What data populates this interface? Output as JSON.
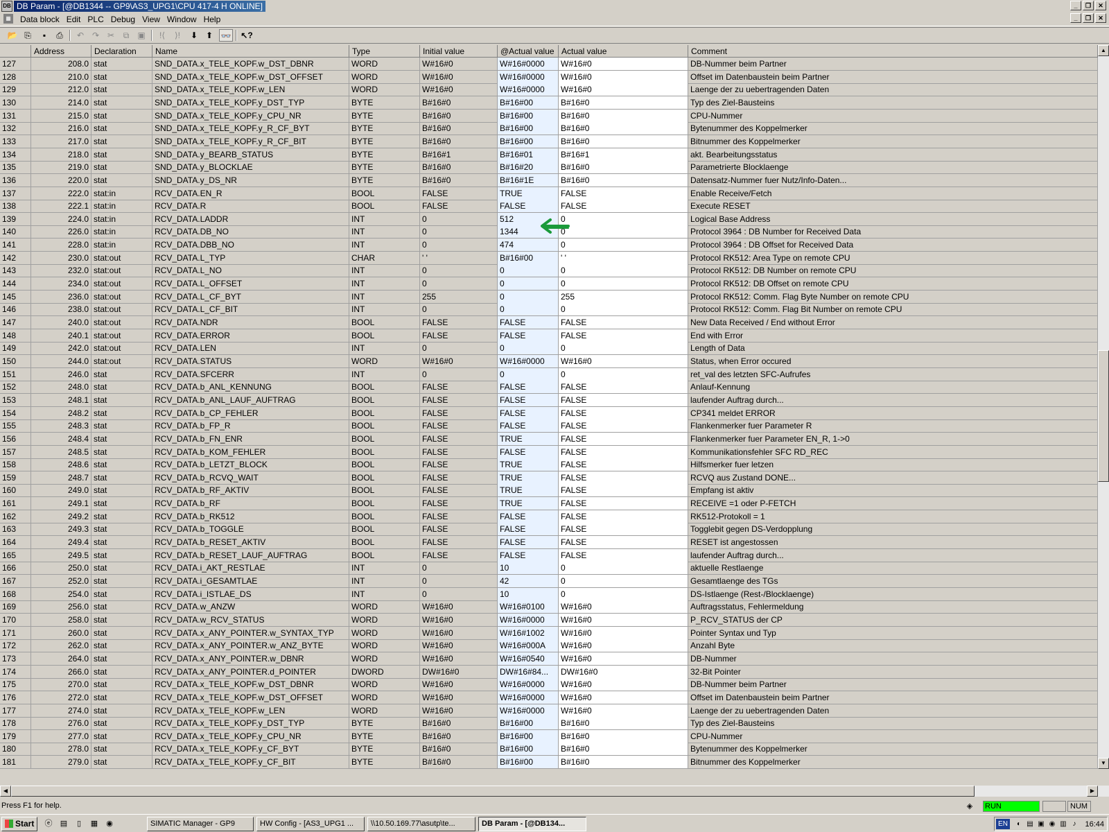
{
  "window": {
    "title": "DB Param - [@DB1344 -- GP9\\AS3_UPG1\\CPU 417-4 H  ONLINE]",
    "sys_icon": "DB"
  },
  "menu": [
    "Data block",
    "Edit",
    "PLC",
    "Debug",
    "View",
    "Window",
    "Help"
  ],
  "toolbar_icons": [
    "open-icon",
    "network-icon",
    "save-icon",
    "print-icon",
    "undo-icon",
    "redo-icon",
    "cut-icon",
    "copy-icon",
    "paste-icon",
    "breakpoint-icon",
    "step-icon",
    "download-icon",
    "upload-icon",
    "monitor-icon",
    "help-icon"
  ],
  "columns": [
    "Address",
    "Declaration",
    "Name",
    "Type",
    "Initial value",
    "@Actual value",
    "Actual value",
    "Comment"
  ],
  "rows": [
    [
      "127",
      "208.0",
      "stat",
      "SND_DATA.x_TELE_KOPF.w_DST_DBNR",
      "WORD",
      "W#16#0",
      "W#16#0000",
      "W#16#0",
      "DB-Nummer beim Partner"
    ],
    [
      "128",
      "210.0",
      "stat",
      "SND_DATA.x_TELE_KOPF.w_DST_OFFSET",
      "WORD",
      "W#16#0",
      "W#16#0000",
      "W#16#0",
      "Offset im Datenbaustein beim Partner"
    ],
    [
      "129",
      "212.0",
      "stat",
      "SND_DATA.x_TELE_KOPF.w_LEN",
      "WORD",
      "W#16#0",
      "W#16#0000",
      "W#16#0",
      "Laenge der zu uebertragenden Daten"
    ],
    [
      "130",
      "214.0",
      "stat",
      "SND_DATA.x_TELE_KOPF.y_DST_TYP",
      "BYTE",
      "B#16#0",
      "B#16#00",
      "B#16#0",
      "Typ des Ziel-Bausteins"
    ],
    [
      "131",
      "215.0",
      "stat",
      "SND_DATA.x_TELE_KOPF.y_CPU_NR",
      "BYTE",
      "B#16#0",
      "B#16#00",
      "B#16#0",
      "CPU-Nummer"
    ],
    [
      "132",
      "216.0",
      "stat",
      "SND_DATA.x_TELE_KOPF.y_R_CF_BYT",
      "BYTE",
      "B#16#0",
      "B#16#00",
      "B#16#0",
      "Bytenummer des Koppelmerker"
    ],
    [
      "133",
      "217.0",
      "stat",
      "SND_DATA.x_TELE_KOPF.y_R_CF_BIT",
      "BYTE",
      "B#16#0",
      "B#16#00",
      "B#16#0",
      "Bitnummer  des Koppelmerker"
    ],
    [
      "134",
      "218.0",
      "stat",
      "SND_DATA.y_BEARB_STATUS",
      "BYTE",
      "B#16#1",
      "B#16#01",
      "B#16#1",
      "akt. Bearbeitungsstatus"
    ],
    [
      "135",
      "219.0",
      "stat",
      "SND_DATA.y_BLOCKLAE",
      "BYTE",
      "B#16#0",
      "B#16#20",
      "B#16#0",
      "Parametrierte Blocklaenge"
    ],
    [
      "136",
      "220.0",
      "stat",
      "SND_DATA.y_DS_NR",
      "BYTE",
      "B#16#0",
      "B#16#1E",
      "B#16#0",
      "Datensatz-Nummer fuer Nutz/Info-Daten..."
    ],
    [
      "137",
      "222.0",
      "stat:in",
      "RCV_DATA.EN_R",
      "BOOL",
      "FALSE",
      "TRUE",
      "FALSE",
      "Enable Receive/Fetch"
    ],
    [
      "138",
      "222.1",
      "stat:in",
      "RCV_DATA.R",
      "BOOL",
      "FALSE",
      "FALSE",
      "FALSE",
      "Execute RESET"
    ],
    [
      "139",
      "224.0",
      "stat:in",
      "RCV_DATA.LADDR",
      "INT",
      "0",
      "512",
      "0",
      "Logical Base Address"
    ],
    [
      "140",
      "226.0",
      "stat:in",
      "RCV_DATA.DB_NO",
      "INT",
      "0",
      "1344",
      "0",
      "Protocol 3964 : DB Number for Received Data"
    ],
    [
      "141",
      "228.0",
      "stat:in",
      "RCV_DATA.DBB_NO",
      "INT",
      "0",
      "474",
      "0",
      "Protocol 3964 : DB Offset for Received Data"
    ],
    [
      "142",
      "230.0",
      "stat:out",
      "RCV_DATA.L_TYP",
      "CHAR",
      "' '",
      "B#16#00",
      "' '",
      "Protocol RK512: Area Type on remote CPU"
    ],
    [
      "143",
      "232.0",
      "stat:out",
      "RCV_DATA.L_NO",
      "INT",
      "0",
      "0",
      "0",
      "Protocol RK512: DB Number on remote CPU"
    ],
    [
      "144",
      "234.0",
      "stat:out",
      "RCV_DATA.L_OFFSET",
      "INT",
      "0",
      "0",
      "0",
      "Protocol RK512: DB Offset on remote CPU"
    ],
    [
      "145",
      "236.0",
      "stat:out",
      "RCV_DATA.L_CF_BYT",
      "INT",
      "255",
      "0",
      "255",
      "Protocol RK512: Comm. Flag Byte Number on remote CPU"
    ],
    [
      "146",
      "238.0",
      "stat:out",
      "RCV_DATA.L_CF_BIT",
      "INT",
      "0",
      "0",
      "0",
      "Protocol RK512: Comm. Flag Bit  Number on remote CPU"
    ],
    [
      "147",
      "240.0",
      "stat:out",
      "RCV_DATA.NDR",
      "BOOL",
      "FALSE",
      "FALSE",
      "FALSE",
      "New Data Received / End without Error"
    ],
    [
      "148",
      "240.1",
      "stat:out",
      "RCV_DATA.ERROR",
      "BOOL",
      "FALSE",
      "FALSE",
      "FALSE",
      "End with Error"
    ],
    [
      "149",
      "242.0",
      "stat:out",
      "RCV_DATA.LEN",
      "INT",
      "0",
      "0",
      "0",
      "Length of Data"
    ],
    [
      "150",
      "244.0",
      "stat:out",
      "RCV_DATA.STATUS",
      "WORD",
      "W#16#0",
      "W#16#0000",
      "W#16#0",
      "Status, when Error occured"
    ],
    [
      "151",
      "246.0",
      "stat",
      "RCV_DATA.SFCERR",
      "INT",
      "0",
      "0",
      "0",
      "ret_val des letzten SFC-Aufrufes"
    ],
    [
      "152",
      "248.0",
      "stat",
      "RCV_DATA.b_ANL_KENNUNG",
      "BOOL",
      "FALSE",
      "FALSE",
      "FALSE",
      "Anlauf-Kennung"
    ],
    [
      "153",
      "248.1",
      "stat",
      "RCV_DATA.b_ANL_LAUF_AUFTRAG",
      "BOOL",
      "FALSE",
      "FALSE",
      "FALSE",
      "laufender Auftrag durch..."
    ],
    [
      "154",
      "248.2",
      "stat",
      "RCV_DATA.b_CP_FEHLER",
      "BOOL",
      "FALSE",
      "FALSE",
      "FALSE",
      "CP341 meldet ERROR"
    ],
    [
      "155",
      "248.3",
      "stat",
      "RCV_DATA.b_FP_R",
      "BOOL",
      "FALSE",
      "FALSE",
      "FALSE",
      "Flankenmerker fuer Parameter R"
    ],
    [
      "156",
      "248.4",
      "stat",
      "RCV_DATA.b_FN_ENR",
      "BOOL",
      "FALSE",
      "TRUE",
      "FALSE",
      "Flankenmerker fuer Parameter EN_R, 1->0"
    ],
    [
      "157",
      "248.5",
      "stat",
      "RCV_DATA.b_KOM_FEHLER",
      "BOOL",
      "FALSE",
      "FALSE",
      "FALSE",
      "Kommunikationsfehler SFC RD_REC"
    ],
    [
      "158",
      "248.6",
      "stat",
      "RCV_DATA.b_LETZT_BLOCK",
      "BOOL",
      "FALSE",
      "TRUE",
      "FALSE",
      "Hilfsmerker fuer letzen"
    ],
    [
      "159",
      "248.7",
      "stat",
      "RCV_DATA.b_RCVQ_WAIT",
      "BOOL",
      "FALSE",
      "TRUE",
      "FALSE",
      "RCVQ aus Zustand DONE..."
    ],
    [
      "160",
      "249.0",
      "stat",
      "RCV_DATA.b_RF_AKTIV",
      "BOOL",
      "FALSE",
      "TRUE",
      "FALSE",
      "Empfang ist aktiv"
    ],
    [
      "161",
      "249.1",
      "stat",
      "RCV_DATA.b_RF",
      "BOOL",
      "FALSE",
      "TRUE",
      "FALSE",
      "RECEIVE =1 oder P-FETCH"
    ],
    [
      "162",
      "249.2",
      "stat",
      "RCV_DATA.b_RK512",
      "BOOL",
      "FALSE",
      "FALSE",
      "FALSE",
      "RK512-Protokoll = 1"
    ],
    [
      "163",
      "249.3",
      "stat",
      "RCV_DATA.b_TOGGLE",
      "BOOL",
      "FALSE",
      "FALSE",
      "FALSE",
      "Togglebit gegen DS-Verdopplung"
    ],
    [
      "164",
      "249.4",
      "stat",
      "RCV_DATA.b_RESET_AKTIV",
      "BOOL",
      "FALSE",
      "FALSE",
      "FALSE",
      "RESET ist angestossen"
    ],
    [
      "165",
      "249.5",
      "stat",
      "RCV_DATA.b_RESET_LAUF_AUFTRAG",
      "BOOL",
      "FALSE",
      "FALSE",
      "FALSE",
      "laufender Auftrag durch..."
    ],
    [
      "166",
      "250.0",
      "stat",
      "RCV_DATA.i_AKT_RESTLAE",
      "INT",
      "0",
      "10",
      "0",
      "aktuelle Restlaenge"
    ],
    [
      "167",
      "252.0",
      "stat",
      "RCV_DATA.i_GESAMTLAE",
      "INT",
      "0",
      "42",
      "0",
      "Gesamtlaenge des TGs"
    ],
    [
      "168",
      "254.0",
      "stat",
      "RCV_DATA.i_ISTLAE_DS",
      "INT",
      "0",
      "10",
      "0",
      "DS-Istlaenge (Rest-/Blocklaenge)"
    ],
    [
      "169",
      "256.0",
      "stat",
      "RCV_DATA.w_ANZW",
      "WORD",
      "W#16#0",
      "W#16#0100",
      "W#16#0",
      "Auftragsstatus, Fehlermeldung"
    ],
    [
      "170",
      "258.0",
      "stat",
      "RCV_DATA.w_RCV_STATUS",
      "WORD",
      "W#16#0",
      "W#16#0000",
      "W#16#0",
      "P_RCV_STATUS der CP"
    ],
    [
      "171",
      "260.0",
      "stat",
      "RCV_DATA.x_ANY_POINTER.w_SYNTAX_TYP",
      "WORD",
      "W#16#0",
      "W#16#1002",
      "W#16#0",
      "Pointer Syntax und Typ"
    ],
    [
      "172",
      "262.0",
      "stat",
      "RCV_DATA.x_ANY_POINTER.w_ANZ_BYTE",
      "WORD",
      "W#16#0",
      "W#16#000A",
      "W#16#0",
      "Anzahl Byte"
    ],
    [
      "173",
      "264.0",
      "stat",
      "RCV_DATA.x_ANY_POINTER.w_DBNR",
      "WORD",
      "W#16#0",
      "W#16#0540",
      "W#16#0",
      "DB-Nummer"
    ],
    [
      "174",
      "266.0",
      "stat",
      "RCV_DATA.x_ANY_POINTER.d_POINTER",
      "DWORD",
      "DW#16#0",
      "DW#16#84...",
      "DW#16#0",
      "32-Bit Pointer"
    ],
    [
      "175",
      "270.0",
      "stat",
      "RCV_DATA.x_TELE_KOPF.w_DST_DBNR",
      "WORD",
      "W#16#0",
      "W#16#0000",
      "W#16#0",
      "DB-Nummer beim Partner"
    ],
    [
      "176",
      "272.0",
      "stat",
      "RCV_DATA.x_TELE_KOPF.w_DST_OFFSET",
      "WORD",
      "W#16#0",
      "W#16#0000",
      "W#16#0",
      "Offset im Datenbaustein beim Partner"
    ],
    [
      "177",
      "274.0",
      "stat",
      "RCV_DATA.x_TELE_KOPF.w_LEN",
      "WORD",
      "W#16#0",
      "W#16#0000",
      "W#16#0",
      "Laenge der zu uebertragenden Daten"
    ],
    [
      "178",
      "276.0",
      "stat",
      "RCV_DATA.x_TELE_KOPF.y_DST_TYP",
      "BYTE",
      "B#16#0",
      "B#16#00",
      "B#16#0",
      "Typ des Ziel-Bausteins"
    ],
    [
      "179",
      "277.0",
      "stat",
      "RCV_DATA.x_TELE_KOPF.y_CPU_NR",
      "BYTE",
      "B#16#0",
      "B#16#00",
      "B#16#0",
      "CPU-Nummer"
    ],
    [
      "180",
      "278.0",
      "stat",
      "RCV_DATA.x_TELE_KOPF.y_CF_BYT",
      "BYTE",
      "B#16#0",
      "B#16#00",
      "B#16#0",
      "Bytenummer des Koppelmerker"
    ],
    [
      "181",
      "279.0",
      "stat",
      "RCV_DATA.x_TELE_KOPF.y_CF_BIT",
      "BYTE",
      "B#16#0",
      "B#16#00",
      "B#16#0",
      "Bitnummer  des Koppelmerker"
    ]
  ],
  "status": {
    "help": "Press F1 for help.",
    "mode": "RUN",
    "num": "NUM"
  },
  "taskbar": {
    "start": "Start",
    "tasks": [
      "SIMATIC Manager - GP9",
      "HW Config - [AS3_UPG1 ...",
      "\\\\10.50.169.77\\asutp\\te...",
      "DB Param - [@DB134..."
    ],
    "lang": "EN",
    "clock": "16:44"
  },
  "colors": {
    "run": "#00ff00",
    "title": "#0a246a",
    "arrow": "#1a9a3a"
  }
}
